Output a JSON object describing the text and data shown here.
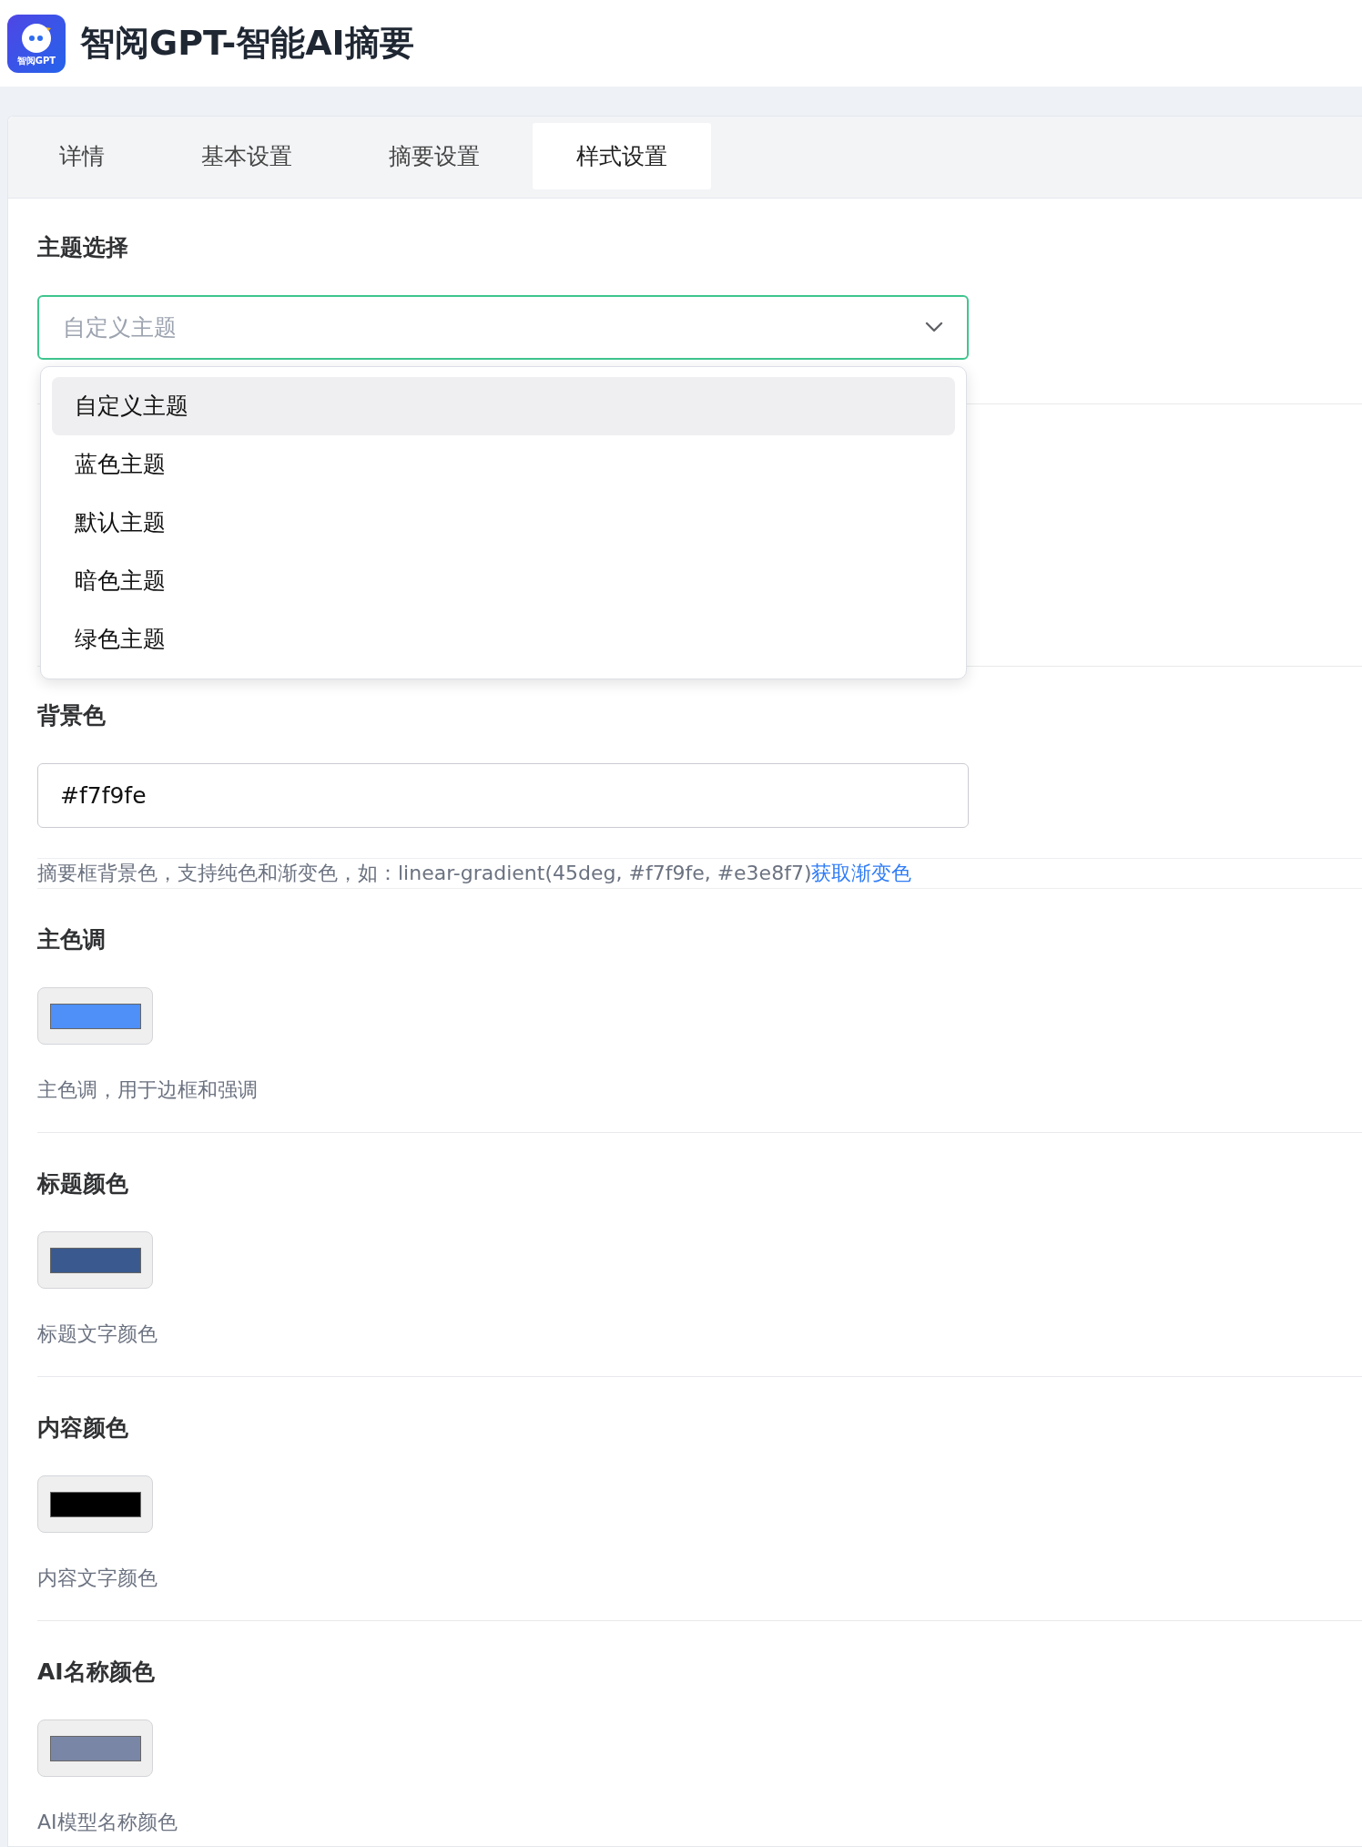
{
  "app": {
    "title": "智阅GPT-智能AI摘要",
    "logo_text": "智阅GPT"
  },
  "tabs": [
    {
      "label": "详情",
      "selected": false
    },
    {
      "label": "基本设置",
      "selected": false
    },
    {
      "label": "摘要设置",
      "selected": false
    },
    {
      "label": "样式设置",
      "selected": true
    }
  ],
  "theme": {
    "label": "主题选择",
    "placeholder": "自定义主题",
    "options": [
      {
        "label": "自定义主题",
        "selected": true
      },
      {
        "label": "蓝色主题",
        "selected": false
      },
      {
        "label": "默认主题",
        "selected": false
      },
      {
        "label": "暗色主题",
        "selected": false
      },
      {
        "label": "绿色主题",
        "selected": false
      }
    ]
  },
  "background": {
    "label": "背景色",
    "value": "#f7f9fe",
    "help": "摘要框背景色，支持纯色和渐变色，如：linear-gradient(45deg, #f7f9fe, #e3e8f7)",
    "link": "获取渐变色"
  },
  "colors": [
    {
      "label": "主色调",
      "color": "#4e8ff8",
      "help": "主色调，用于边框和强调"
    },
    {
      "label": "标题颜色",
      "color": "#3a5a8f",
      "help": "标题文字颜色"
    },
    {
      "label": "内容颜色",
      "color": "#000000",
      "help": "内容文字颜色"
    },
    {
      "label": "AI名称颜色",
      "color": "#7a86a6",
      "help": "AI模型名称颜色"
    }
  ]
}
